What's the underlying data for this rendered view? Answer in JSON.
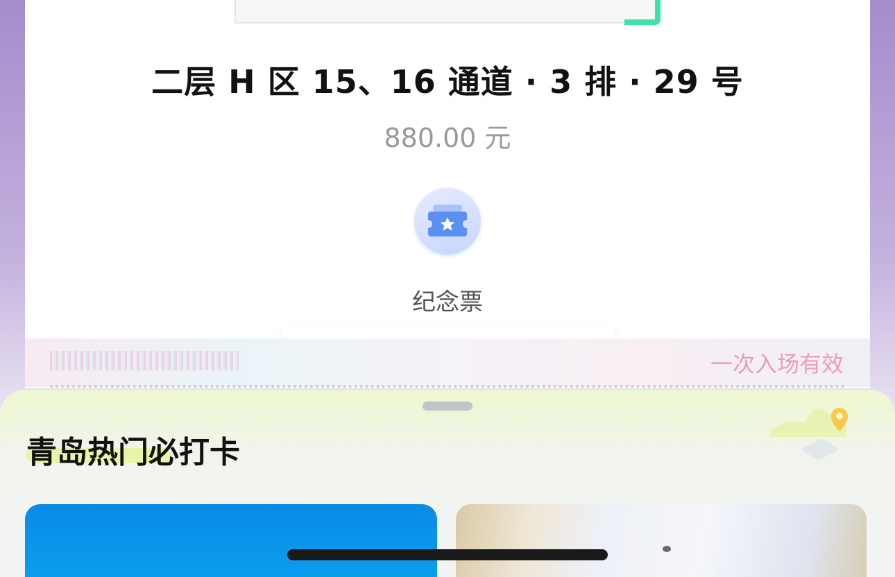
{
  "ticket": {
    "seat_info": "二层 H 区 15、16 通道 · 3 排 · 29 号",
    "price": "880.00 元",
    "souvenir_label": "纪念票",
    "validity": "一次入场有效"
  },
  "sheet": {
    "title": "青岛热门必打卡"
  },
  "colors": {
    "qr_corner": "#3ee2a4",
    "validity_text": "#ef9bbf",
    "souvenir_icon": "#5b8ff0"
  },
  "icons": {
    "souvenir": "ticket-star-icon",
    "map": "map-pin-icon"
  }
}
